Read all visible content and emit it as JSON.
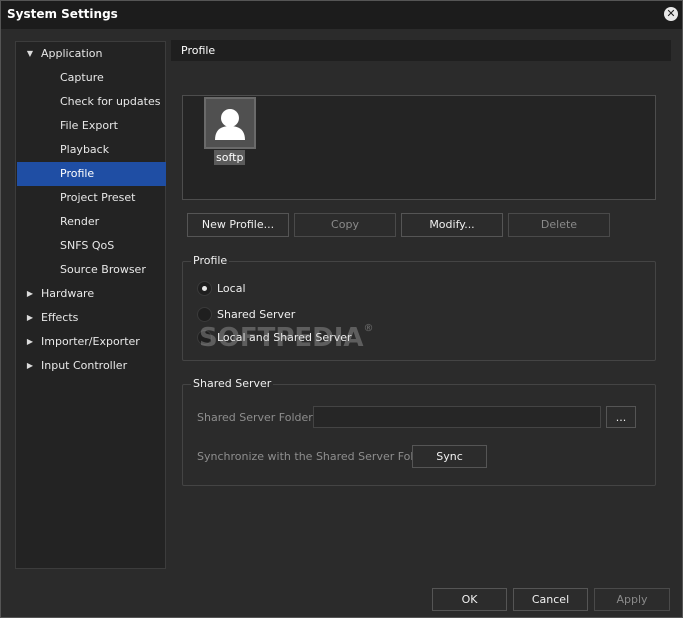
{
  "window": {
    "title": "System Settings",
    "close_icon": "close-icon"
  },
  "colors": {
    "selection": "#1f4ea4",
    "background": "#2b2b2b",
    "titlebar": "#1c1c1c"
  },
  "tree": {
    "items": [
      {
        "label": "Application",
        "level": 0,
        "expanded": true
      },
      {
        "label": "Capture",
        "level": 1
      },
      {
        "label": "Check for updates",
        "level": 1
      },
      {
        "label": "File Export",
        "level": 1
      },
      {
        "label": "Playback",
        "level": 1
      },
      {
        "label": "Profile",
        "level": 1,
        "selected": true
      },
      {
        "label": "Project Preset",
        "level": 1
      },
      {
        "label": "Render",
        "level": 1
      },
      {
        "label": "SNFS QoS",
        "level": 1
      },
      {
        "label": "Source Browser",
        "level": 1
      },
      {
        "label": "Hardware",
        "level": 0,
        "expanded": false
      },
      {
        "label": "Effects",
        "level": 0,
        "expanded": false
      },
      {
        "label": "Importer/Exporter",
        "level": 0,
        "expanded": false
      },
      {
        "label": "Input Controller",
        "level": 0,
        "expanded": false
      }
    ]
  },
  "main": {
    "header": "Profile",
    "profile_tile": {
      "name": "softp",
      "icon": "user-avatar-icon"
    },
    "buttons": {
      "new_profile": "New Profile...",
      "copy": "Copy",
      "modify": "Modify...",
      "delete": "Delete"
    },
    "profile_group": {
      "label": "Profile",
      "options": [
        "Local",
        "Shared Server",
        "Local and Shared Server"
      ],
      "selected": "Local"
    },
    "shared_server_group": {
      "label": "Shared Server",
      "folder_label": "Shared Server Folder",
      "folder_value": "",
      "browse_label": "...",
      "sync_text": "Synchronize with the Shared Server Folder",
      "sync_button": "Sync"
    }
  },
  "footer": {
    "ok": "OK",
    "cancel": "Cancel",
    "apply": "Apply"
  },
  "watermark": {
    "text": "SOFTPEDIA",
    "mark": "®"
  }
}
